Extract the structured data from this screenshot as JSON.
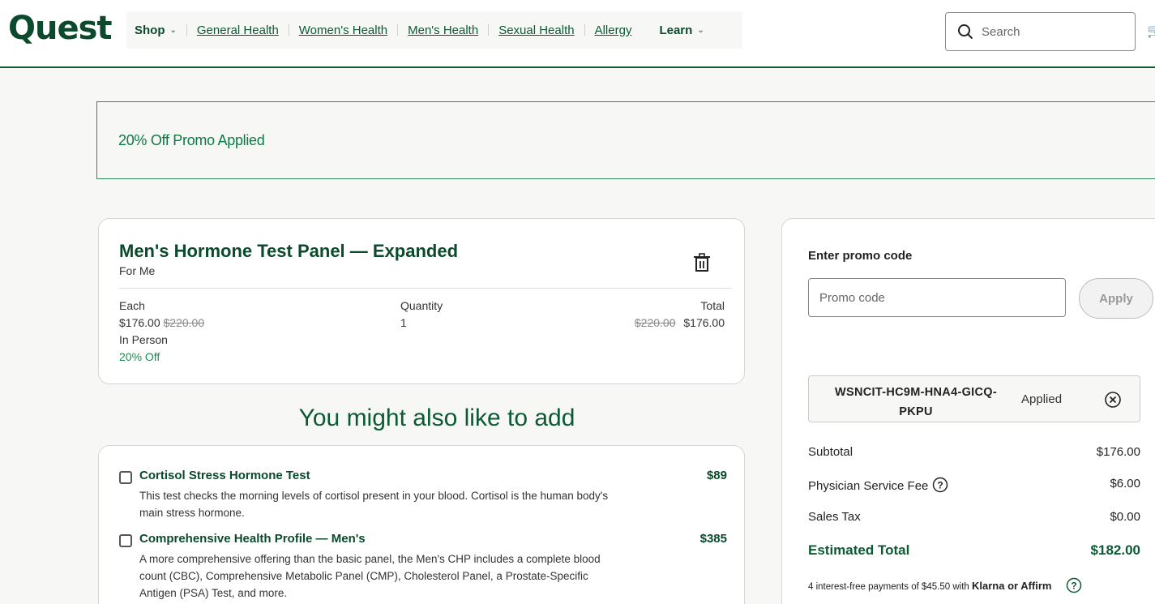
{
  "header": {
    "logo": "Quest",
    "nav": [
      {
        "label": "Shop",
        "dropdown": true
      },
      {
        "label": "General Health"
      },
      {
        "label": "Women's Health"
      },
      {
        "label": "Men's Health"
      },
      {
        "label": "Sexual Health"
      },
      {
        "label": "Allergy"
      },
      {
        "label": "Learn",
        "dropdown": true
      }
    ],
    "search_placeholder": "Search"
  },
  "banner": {
    "text": "20% Off Promo Applied"
  },
  "product": {
    "title": "Men's Hormone Test Panel — Expanded",
    "subtitle": "For Me",
    "each_label": "Each",
    "each_price": "$176.00",
    "each_original": "$220.00",
    "visit_type": "In Person",
    "discount": "20% Off",
    "quantity_label": "Quantity",
    "quantity": "1",
    "total_label": "Total",
    "total_original": "$220.00",
    "total_price": "$176.00"
  },
  "upsell": {
    "heading": "You might also like to add",
    "items": [
      {
        "name": "Cortisol Stress Hormone Test",
        "price": "$89",
        "description": "This test checks the morning levels of cortisol present in your blood. Cortisol is the human body's main stress hormone."
      },
      {
        "name": "Comprehensive Health Profile — Men's",
        "price": "$385",
        "description": "A more comprehensive offering than the basic panel, the Men's CHP includes a complete blood count (CBC), Comprehensive Metabolic Panel (CMP), Cholesterol Panel, a Prostate-Specific Antigen (PSA) Test, and more."
      }
    ]
  },
  "summary": {
    "promo_label": "Enter promo code",
    "promo_placeholder": "Promo code",
    "apply_label": "Apply",
    "applied_code": "WSNCIT-HC9M-HNA4-GICQ-PKPU",
    "applied_status": "Applied",
    "subtotal_label": "Subtotal",
    "subtotal": "$176.00",
    "fee_label": "Physician Service Fee",
    "fee": "$6.00",
    "tax_label": "Sales Tax",
    "tax": "$0.00",
    "total_label": "Estimated Total",
    "total": "$182.00",
    "installments_text": "4 interest-free payments of $45.50 with",
    "installments_providers": "Klarna or Affirm"
  },
  "colors": {
    "brand": "#0b4a2c",
    "accent": "#1f8a55"
  }
}
